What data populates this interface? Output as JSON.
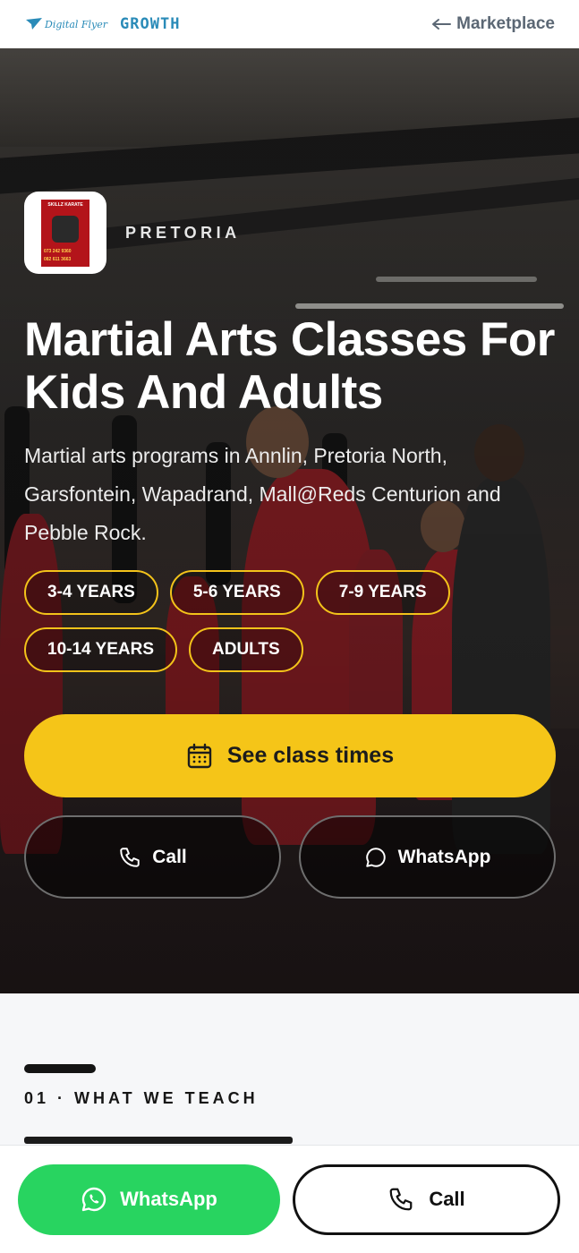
{
  "header": {
    "brand_logo_text": "Digital Flyer",
    "brand_suffix": "GROWTH",
    "back_label": "Marketplace"
  },
  "hero": {
    "logo_flyer_title": "SKILLZ KARATE",
    "logo_flyer_phone_1": "073 242 9360",
    "logo_flyer_phone_2": "082 611 3663",
    "location": "PRETORIA",
    "title": "Martial Arts Classes For Kids And Adults",
    "description": "Martial arts programs in Annlin, Pretoria North, Garsfontein, Wapadrand, Mall@Reds Centurion and Pebble Rock.",
    "age_tags": [
      "3-4 YEARS",
      "5-6 YEARS",
      "7-9 YEARS",
      "10-14 YEARS",
      "ADULTS"
    ],
    "primary_cta": "See class times",
    "call_label": "Call",
    "whatsapp_label": "WhatsApp"
  },
  "section": {
    "label": "01 · WHAT WE TEACH"
  },
  "bottom_bar": {
    "whatsapp_label": "WhatsApp",
    "call_label": "Call"
  },
  "colors": {
    "accent_yellow": "#f5c518",
    "whatsapp_green": "#28d460",
    "brand_blue": "#2a8bb8"
  },
  "icons": [
    "arrow-left-icon",
    "calendar-icon",
    "phone-icon",
    "chat-bubble-icon",
    "whatsapp-icon"
  ]
}
